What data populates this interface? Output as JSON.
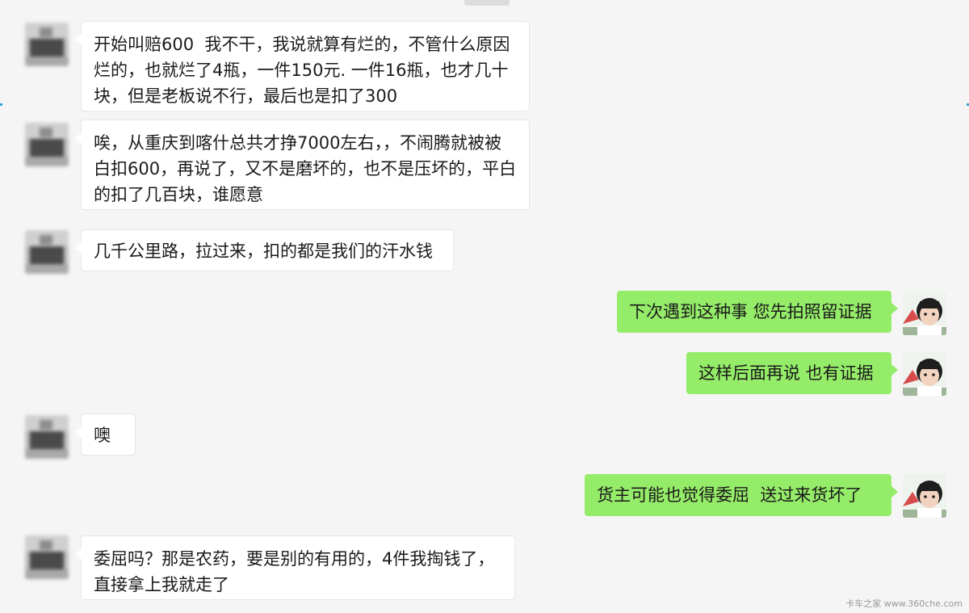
{
  "chat": {
    "messages": [
      {
        "side": "left",
        "text": "开始叫赔600  我不干，我说就算有烂的，不管什么原因烂的，也就烂了4瓶，一件150元. 一件16瓶，也才几十块，但是老板说不行，最后也是扣了300"
      },
      {
        "side": "left",
        "text": "唉，从重庆到喀什总共才挣7000左右，，不闹腾就被被白扣600，再说了，又不是磨坏的，也不是压坏的，平白的扣了几百块，谁愿意"
      },
      {
        "side": "left",
        "text": "几千公里路，拉过来，扣的都是我们的汗水钱"
      },
      {
        "side": "right",
        "text": "下次遇到这种事 您先拍照留证据"
      },
      {
        "side": "right",
        "text": "这样后面再说 也有证据"
      },
      {
        "side": "left",
        "text": "噢"
      },
      {
        "side": "right",
        "text": "货主可能也觉得委屈  送过来货坏了"
      },
      {
        "side": "left",
        "text": "委屈吗？那是农药，要是别的有用的，4件我掏钱了，直接拿上我就走了"
      }
    ]
  },
  "watermark": "卡车之家 www.360che.com",
  "colors": {
    "background": "#f5f5f5",
    "left_bubble": "#ffffff",
    "right_bubble": "#95ec69"
  }
}
